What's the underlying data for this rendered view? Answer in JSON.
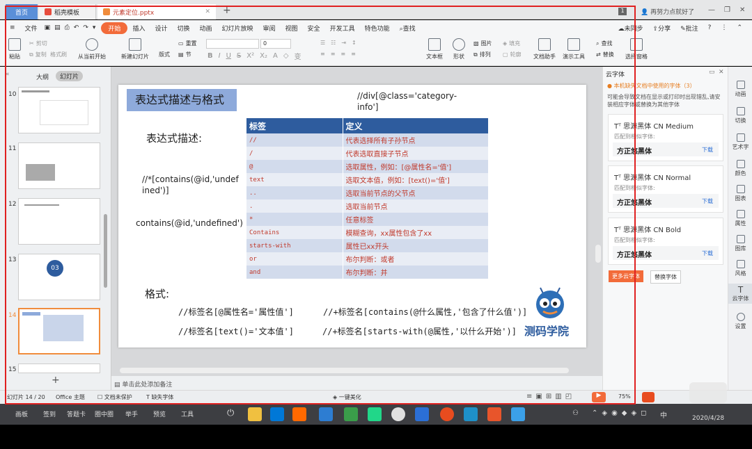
{
  "titlebar": {
    "tab_home": "首页",
    "tab_templates": "稻壳模板",
    "tab_doc": "元素定位.pptx",
    "new_tab": "+",
    "page_badge": "1",
    "user_text": "再努力点就好了"
  },
  "menubar": {
    "file": "文件",
    "items": [
      "开始",
      "插入",
      "设计",
      "切换",
      "动画",
      "幻灯片放映",
      "审阅",
      "视图",
      "安全",
      "开发工具",
      "特色功能"
    ],
    "search": "查找",
    "sync": "未同步",
    "share": "分享",
    "comment": "批注"
  },
  "toolbar": {
    "paste": "粘贴",
    "cut": "剪切",
    "copy": "复制",
    "format_painter": "格式刷",
    "from_current": "从当前开始",
    "new_slide": "新建幻灯片",
    "layout": "版式",
    "section": "节",
    "reset": "重置",
    "font_size": "0",
    "textbox": "文本框",
    "shape": "形状",
    "picture": "图片",
    "arrange": "排列",
    "fill": "填充",
    "outline": "轮廓",
    "doc_assistant": "文档助手",
    "presenter_tools": "演示工具",
    "find": "查找",
    "replace": "替换",
    "select_pane": "选择窗格"
  },
  "leftpanel": {
    "tab_outline": "大纲",
    "tab_slides": "幻灯片",
    "slide_numbers": [
      "10",
      "11",
      "12",
      "13",
      "14",
      "15"
    ],
    "thumb13_text": "03"
  },
  "slide": {
    "title": "表达式描述与格式",
    "xpath_top": "//div[@class='category-info']",
    "desc_label": "表达式描述:",
    "expr1": "//*[contains(@id,'undefined')]",
    "expr2": "contains(@id,'undefined')",
    "format_label": "格式:",
    "fmt1": "//标签名[@属性名='属性值']",
    "fmt2": "//+标签名[contains(@什么属性,'包含了什么值')]",
    "fmt3": "//标签名[text()='文本值']",
    "fmt4": "//+标签名[starts-with(@属性,'以什么开始')]",
    "logo_text": "测码学院",
    "table": {
      "headers": [
        "标签",
        "定义"
      ],
      "rows": [
        [
          "//",
          "代表选择所有子孙节点"
        ],
        [
          "/",
          "代表选取直接子节点"
        ],
        [
          "@",
          "选取属性，例如：[@属性名='值']"
        ],
        [
          "text",
          "选取文本值，例如：[text()='值']"
        ],
        [
          "..",
          "选取当前节点的父节点"
        ],
        [
          ".",
          "选取当前节点"
        ],
        [
          "*",
          "任意标签"
        ],
        [
          "Contains",
          "模糊查询，xx属性包含了xx"
        ],
        [
          "starts-with",
          "属性已xx开头"
        ],
        [
          "or",
          "布尔判断：或者"
        ],
        [
          "and",
          "布尔判断：并"
        ]
      ]
    }
  },
  "notes_placeholder": "单击此处添加备注",
  "rightpanel": {
    "title": "云字体",
    "warning": "本机缺失文档中使用的字体（3）",
    "desc": "可能会导致文档在显示或打印时出现错乱,请安装相应字体或替换为其他字体",
    "fonts": [
      {
        "name": "思源黑体 CN Medium",
        "match_label": "匹配到相似字体:",
        "match": "方正悠黑体",
        "action": "下载"
      },
      {
        "name": "思源黑体 CN Normal",
        "match_label": "匹配到相似字体:",
        "match": "方正悠黑体",
        "action": "下载"
      },
      {
        "name": "思源黑体 CN Bold",
        "match_label": "匹配到相似字体:",
        "match": "方正悠黑体",
        "action": "下载"
      }
    ],
    "more_btn": "更多云字体",
    "replace_btn": "替换字体"
  },
  "farright": [
    "动画",
    "切换",
    "艺术字",
    "颜色",
    "图表",
    "属性",
    "图库",
    "风格",
    "云字体",
    "设置"
  ],
  "statusbar": {
    "slide_count": "幻灯片 14 / 20",
    "theme": "Office 主题",
    "protect": "文档未保护",
    "missing_font": "缺失字体",
    "beautify": "一键美化",
    "zoom": "75%"
  },
  "taskbar": {
    "items": [
      "画板",
      "签到",
      "答题卡",
      "圈中圈",
      "举手",
      "预览",
      "工具"
    ],
    "ime": "中",
    "date": "2020/4/28"
  },
  "colors": {
    "accent": "#f26b3a",
    "title_box": "#8eaadb",
    "table_header": "#2e5c9e",
    "table_text": "#c0392b",
    "red_frame": "#e02020"
  }
}
